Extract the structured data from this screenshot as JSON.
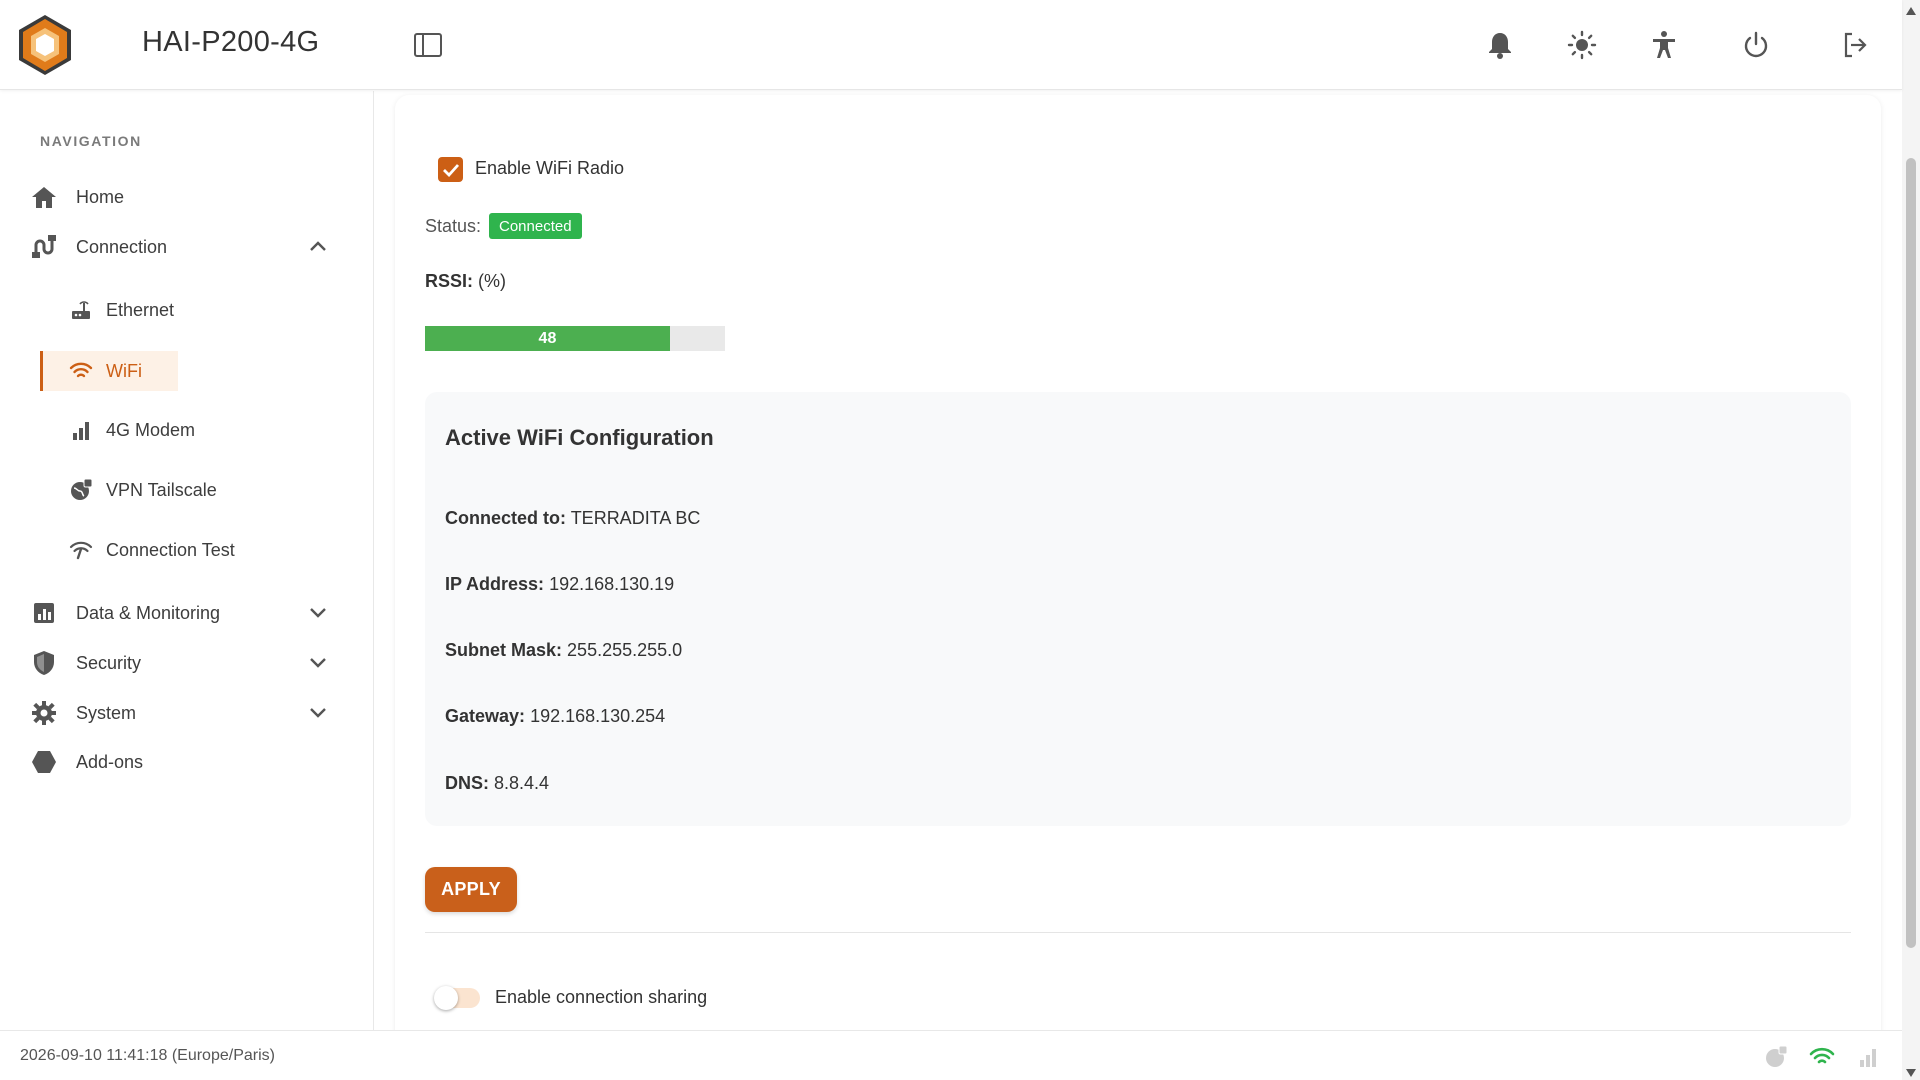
{
  "header": {
    "title": "HAI-P200-4G",
    "icons": [
      "sidebar-toggle-icon",
      "bell-icon",
      "sun-icon",
      "accessibility-icon",
      "power-icon",
      "logout-icon"
    ]
  },
  "sidebar": {
    "heading": "NAVIGATION",
    "items": {
      "home": "Home",
      "connection": "Connection",
      "ethernet": "Ethernet",
      "wifi": "WiFi",
      "modem": "4G Modem",
      "vpn": "VPN Tailscale",
      "conntest": "Connection Test",
      "data": "Data & Monitoring",
      "security": "Security",
      "system": "System",
      "addons": "Add-ons"
    }
  },
  "wifi": {
    "enable_label": "Enable WiFi Radio",
    "enabled": true,
    "status_label": "Status:",
    "status_value": "Connected",
    "rssi_label": "RSSI:",
    "rssi_unit": "(%)",
    "rssi_value": 48,
    "rssi_text": "48"
  },
  "config": {
    "title": "Active WiFi Configuration",
    "connected_label": "Connected to:",
    "connected_value": "TERRADITA BC",
    "ip_label": "IP Address:",
    "ip_value": "192.168.130.19",
    "subnet_label": "Subnet Mask:",
    "subnet_value": "255.255.255.0",
    "gateway_label": "Gateway:",
    "gateway_value": "192.168.130.254",
    "dns_label": "DNS:",
    "dns_value": "8.8.4.4"
  },
  "actions": {
    "apply": "APPLY",
    "sharing_label": "Enable connection sharing",
    "sharing_enabled": false
  },
  "footer": {
    "datetime": "2026-09-10 11:41:18 (Europe/Paris)"
  },
  "colors": {
    "accent": "#cc5f15",
    "success": "#2fb44d",
    "progress": "#4caf50"
  }
}
